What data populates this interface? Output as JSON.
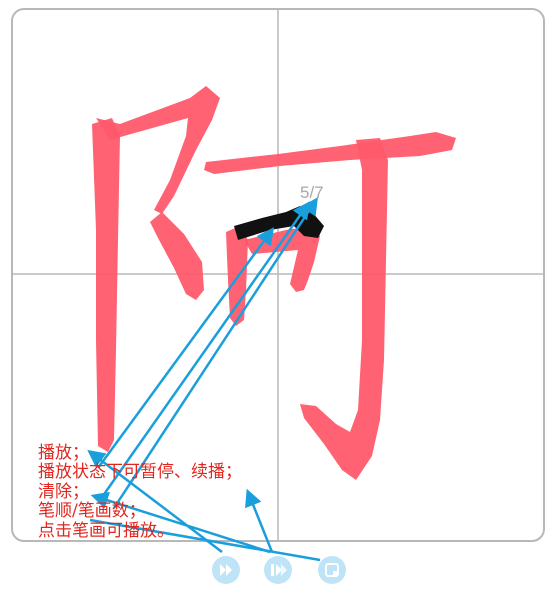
{
  "stroke_counter": "5/7",
  "notes": {
    "play": "播放；",
    "pause_resume": "播放状态下可暂停、续播；",
    "clear": "清除；",
    "stroke_order": "笔顺/笔画数；",
    "click_to_play": "点击笔画可播放。"
  },
  "controls": {
    "play_icon": "play-icon",
    "step_icon": "step-play-icon",
    "clear_icon": "clear-icon"
  },
  "colors": {
    "stroke": "#ff5a6a",
    "current_stroke": "#111111",
    "arrow": "#1a9fdc",
    "note_text": "#e0261e",
    "grid": "#b5b5b5",
    "button": "#bfe3f7"
  }
}
